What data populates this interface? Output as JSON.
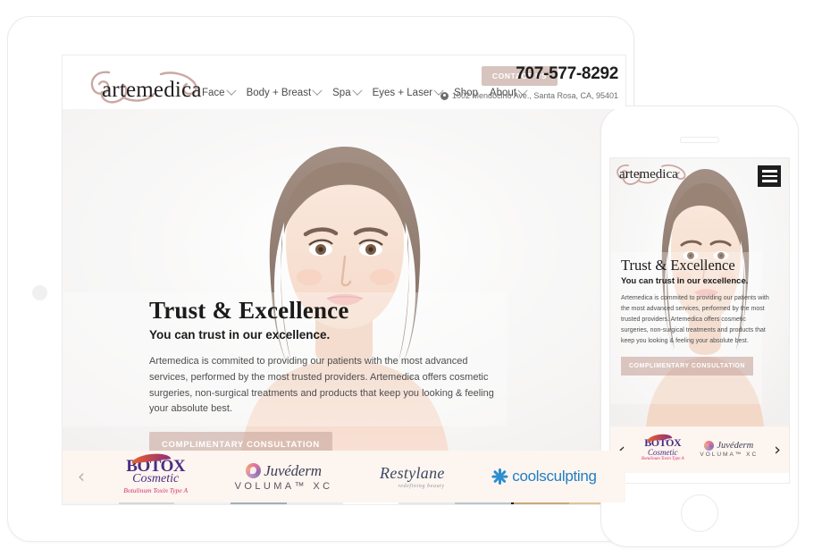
{
  "site": {
    "logo_text": "artemedica",
    "nav": [
      {
        "label": "Face",
        "has_dropdown": true
      },
      {
        "label": "Body + Breast",
        "has_dropdown": true
      },
      {
        "label": "Spa",
        "has_dropdown": true
      },
      {
        "label": "Eyes + Laser",
        "has_dropdown": true
      },
      {
        "label": "Shop",
        "has_dropdown": false
      },
      {
        "label": "About",
        "has_dropdown": true
      }
    ],
    "contact_button": "CONTACT US",
    "phone": "707-577-8292",
    "address": "1002 Mendocino Ave., Santa Rosa, CA, 95401",
    "address_icon": "location-pin-icon"
  },
  "hero": {
    "headline": "Trust & Excellence",
    "subheadline": "You can trust in our excellence.",
    "body": "Artemedica is commited to providing our patients with the most advanced services, performed by the most trusted providers. Artemedica offers cosmetic surgeries, non-surgical treatments and products that keep you looking & feeling your absolute best.",
    "cta": "COMPLIMENTARY CONSULTATION",
    "image_alt": "smiling-woman-portrait"
  },
  "carousel": {
    "prev_icon": "chevron-left-icon",
    "next_icon": "chevron-right-icon",
    "brands": [
      {
        "name": "BOTOX",
        "line1": "BOTOX",
        "line2": "Cosmetic",
        "line3": "Botulinum Toxin Type A"
      },
      {
        "name": "Juvederm",
        "line1": "Juvéderm",
        "line2": "VOLUMA™ XC"
      },
      {
        "name": "Restylane",
        "line1": "Restylane",
        "line2": "redefining beauty"
      },
      {
        "name": "Coolsculpting",
        "line1": "coolsculpting",
        "line2": ""
      }
    ]
  },
  "mobile": {
    "logo_text": "artemedica",
    "menu_icon": "hamburger-menu-icon",
    "headline": "Trust & Excellence",
    "subheadline": "You can trust in our excellence.",
    "body": "Artemedica is commited to providing our patients with the most advanced services, performed by the most trusted providers. Artemedica offers cosmetic surgeries, non-surgical treatments and products that keep you looking & feeling your absolute best.",
    "cta": "COMPLIMENTARY CONSULTATION",
    "brands": [
      {
        "line1": "BOTOX",
        "line2": "Cosmetic",
        "line3": "Botulinum Toxin Type A"
      },
      {
        "line1": "Juvéderm",
        "line2": "VOLUMA™ XC"
      }
    ]
  },
  "colors": {
    "accent_mauve": "#d8c4be",
    "carousel_bg": "#fdf5ef",
    "text_dark": "#1b1b1b",
    "botox_purple": "#4b2d83",
    "botox_pink": "#d4306e",
    "coolsculpting_blue": "#1f7fc4"
  }
}
